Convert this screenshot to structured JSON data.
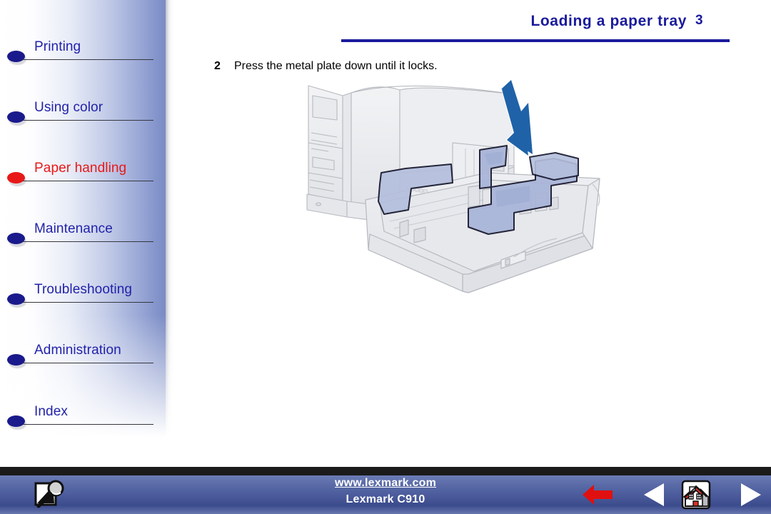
{
  "document": {
    "title": "Loading a paper tray",
    "page_number": "3"
  },
  "sidebar": {
    "items": [
      {
        "label": "Printing",
        "bullet": "bullet-icon",
        "state": "normal"
      },
      {
        "label": "Using color",
        "bullet": "bullet-icon",
        "state": "normal"
      },
      {
        "label": "Paper handling",
        "bullet": "bullet-icon",
        "state": "active"
      },
      {
        "label": "Maintenance",
        "bullet": "bullet-icon",
        "state": "normal"
      },
      {
        "label": "Troubleshooting",
        "bullet": "bullet-icon",
        "state": "normal"
      },
      {
        "label": "Administration",
        "bullet": "bullet-icon",
        "state": "normal"
      },
      {
        "label": "Index",
        "bullet": "bullet-icon",
        "state": "normal"
      }
    ],
    "link_color": "#2222aa",
    "active_color": "#e81818",
    "bullet_color": "#1a1a8c",
    "active_bullet_color": "#e81818"
  },
  "content": {
    "step_number": "2",
    "step_text": "Press the metal plate down until it locks.",
    "illustration": {
      "name": "printer-paper-tray-illustration",
      "description": "Printer with open paper tray, metal plate highlighted, downward arrow",
      "printer_line_color": "#b9bcc2",
      "printer_fill_color": "#eaebee",
      "plate_fill_color": "#a8b4d8",
      "plate_outline_color": "#1a1a2e",
      "arrow_color": "#1f62a8"
    }
  },
  "footer": {
    "url": "www.lexmark.com",
    "model": "Lexmark C910",
    "search_icon": "search-page-magnifier-icon",
    "nav": [
      {
        "name": "back-arrow-button",
        "icon": "arrow-left-solid-icon",
        "color": "#e01010"
      },
      {
        "name": "previous-button",
        "icon": "triangle-left-icon",
        "color": "#ffffff"
      },
      {
        "name": "home-button",
        "icon": "house-icon",
        "color": "#d83126"
      },
      {
        "name": "next-button",
        "icon": "triangle-right-icon",
        "color": "#ffffff"
      }
    ],
    "bar_color": "#49599a",
    "black_bar_color": "#1b1b1b"
  }
}
